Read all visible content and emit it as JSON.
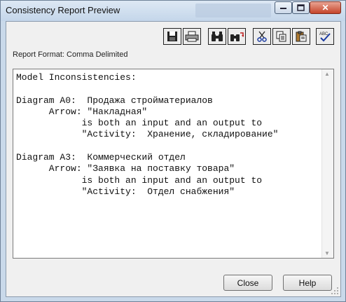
{
  "window": {
    "title": "Consistency Report Preview"
  },
  "report": {
    "format_label": "Report Format: Comma Delimited",
    "lines": [
      "Model Inconsistencies:",
      "",
      "Diagram A0:  Продажа стройматериалов",
      "      Arrow: \"Накладная\"",
      "            is both an input and an output to",
      "            \"Activity:  Хранение, складирование\"",
      "",
      "Diagram A3:  Коммерческий отдел",
      "      Arrow: \"Заявка на поставку товара\"",
      "            is both an input and an output to",
      "            \"Activity:  Отдел снабжения\""
    ]
  },
  "toolbar": {
    "buttons": [
      {
        "id": "save",
        "icon": "floppy-disk-icon"
      },
      {
        "id": "print",
        "icon": "printer-icon"
      },
      {
        "id": "find",
        "icon": "binoculars-icon"
      },
      {
        "id": "replace",
        "icon": "binoculars-replace-icon"
      },
      {
        "id": "cut",
        "icon": "scissors-icon"
      },
      {
        "id": "copy",
        "icon": "copy-icon"
      },
      {
        "id": "paste",
        "icon": "paste-icon"
      },
      {
        "id": "spell",
        "icon": "spellcheck-icon",
        "text": "ABC"
      }
    ]
  },
  "buttons": {
    "close_label": "Close",
    "help_label": "Help"
  },
  "colors": {
    "titlebar": "#c4d6ea",
    "close_button": "#c5442a",
    "client_bg": "#f0f0f0"
  }
}
